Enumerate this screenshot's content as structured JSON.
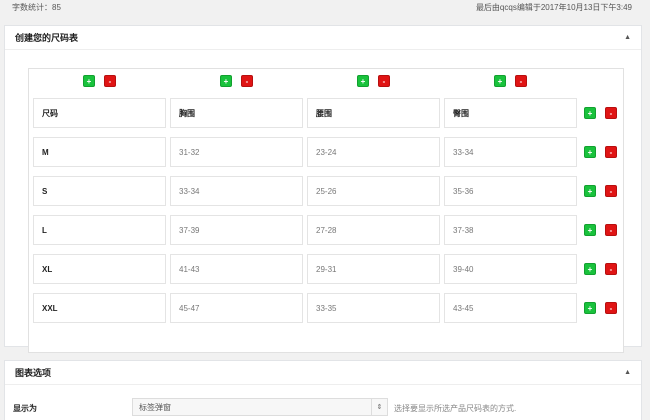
{
  "topbar": {
    "word_count": "字数统计：85",
    "last_edited": "最后由qcqs编辑于2017年10月13日下午3:49"
  },
  "size_panel": {
    "title": "创建您的尺码表",
    "collapse_icon": "caret-up-icon",
    "add_label": "+",
    "remove_label": "-",
    "headers": [
      "尺码",
      "胸围",
      "腰围",
      "臀围"
    ],
    "rows": [
      [
        "M",
        "31-32",
        "23-24",
        "33-34"
      ],
      [
        "S",
        "33-34",
        "25-26",
        "35-36"
      ],
      [
        "L",
        "37-39",
        "27-28",
        "37-38"
      ],
      [
        "XL",
        "41-43",
        "29-31",
        "39-40"
      ],
      [
        "XXL",
        "45-47",
        "33-35",
        "43-45"
      ]
    ]
  },
  "options_panel": {
    "title": "图表选项",
    "collapse_icon": "caret-up-icon",
    "display_label": "显示为",
    "display_value": "标签弹窗",
    "display_hint": "选择要显示所选产品尺码表的方式."
  },
  "colors": {
    "add_button": "#19c23c",
    "remove_button": "#e01414"
  }
}
